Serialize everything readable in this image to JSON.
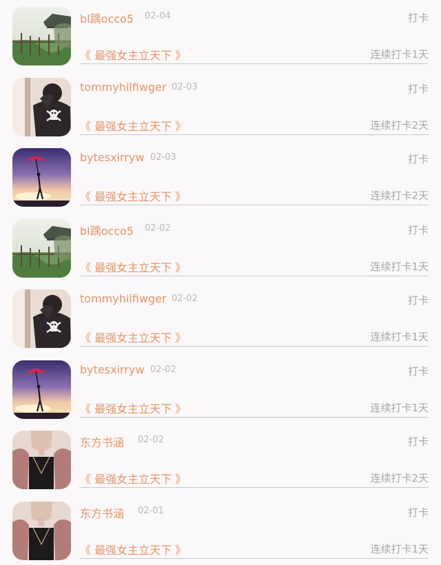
{
  "colors": {
    "accent": "#e8956a",
    "muted": "#a9a9a9",
    "background": "#faf8f8"
  },
  "checkins": [
    {
      "user": "bl踽occo5",
      "date": "02-04",
      "action": "打卡",
      "book": "《 最强女主立天下 》",
      "streak": "连续打卡1天",
      "avatar": "landscape-avatar"
    },
    {
      "user": "tommyhilfiwger",
      "date": "02-03",
      "action": "打卡",
      "book": "《 最强女主立天下 》",
      "streak": "连续打卡2天",
      "avatar": "skull-shirt-avatar"
    },
    {
      "user": "bytesxirryw",
      "date": "02-03",
      "action": "打卡",
      "book": "《 最强女主立天下 》",
      "streak": "连续打卡2天",
      "avatar": "umbrella-sunset-avatar"
    },
    {
      "user": "bl踽occo5",
      "date": "02-02",
      "action": "打卡",
      "book": "《 最强女主立天下 》",
      "streak": "连续打卡1天",
      "avatar": "landscape-avatar"
    },
    {
      "user": "tommyhilfiwger",
      "date": "02-02",
      "action": "打卡",
      "book": "《 最强女主立天下 》",
      "streak": "连续打卡1天",
      "avatar": "skull-shirt-avatar"
    },
    {
      "user": "bytesxirryw",
      "date": "02-02",
      "action": "打卡",
      "book": "《 最强女主立天下 》",
      "streak": "连续打卡1天",
      "avatar": "umbrella-sunset-avatar"
    },
    {
      "user": "东方书涵",
      "date": "02-02",
      "action": "打卡",
      "book": "《 最强女主立天下 》",
      "streak": "连续打卡2天",
      "avatar": "portrait-avatar"
    },
    {
      "user": "东方书涵",
      "date": "02-01",
      "action": "打卡",
      "book": "《 最强女主立天下 》",
      "streak": "连续打卡1天",
      "avatar": "portrait-avatar"
    }
  ]
}
